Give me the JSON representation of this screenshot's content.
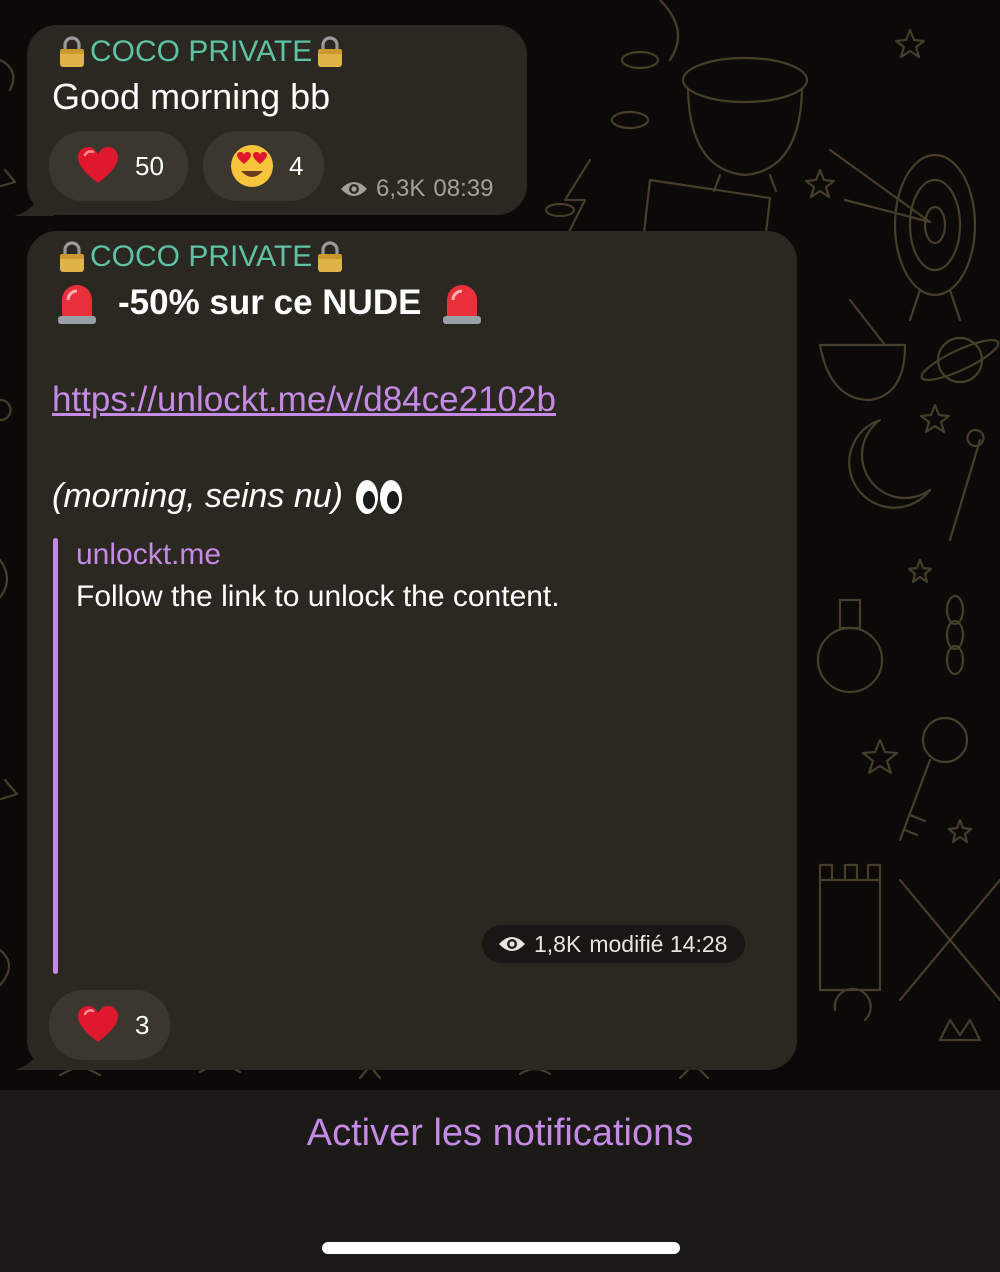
{
  "messages": [
    {
      "sender": "COCO PRIVATE",
      "text": "Good morning bb",
      "reactions": [
        {
          "emoji": "heart-icon",
          "count": "50"
        },
        {
          "emoji": "heart-eyes-icon",
          "count": "4"
        }
      ],
      "views": "6,3K",
      "time": "08:39"
    },
    {
      "sender": "COCO PRIVATE",
      "headline": "-50% sur ce NUDE",
      "link": "https://unlockt.me/v/d84ce2102b",
      "caption": "(morning, seins nu)",
      "preview": {
        "site": "unlockt.me",
        "description": "Follow the link to unlock the content."
      },
      "views": "1,8K",
      "edited_time": "modifié 14:28",
      "reactions": [
        {
          "emoji": "heart-icon",
          "count": "3"
        }
      ]
    }
  ],
  "footer": {
    "notify_label": "Activer les notifications"
  },
  "colors": {
    "accent": "#c58ae5",
    "sender": "#5ec2a5",
    "bubble": "#2b2822"
  }
}
